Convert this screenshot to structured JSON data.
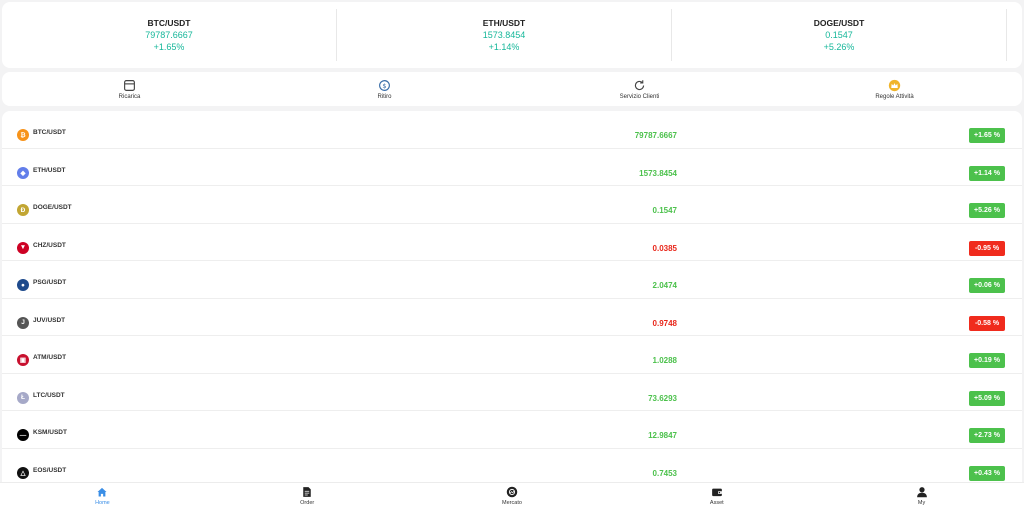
{
  "tickers": [
    {
      "pair": "BTC/USDT",
      "price": "79787.6667",
      "change": "+1.65%"
    },
    {
      "pair": "ETH/USDT",
      "price": "1573.8454",
      "change": "+1.14%"
    },
    {
      "pair": "DOGE/USDT",
      "price": "0.1547",
      "change": "+5.26%"
    }
  ],
  "actions": [
    {
      "label": "Ricarica",
      "icon": "card-icon"
    },
    {
      "label": "Ritiro",
      "icon": "coin-withdraw-icon"
    },
    {
      "label": "Servizio Clienti",
      "icon": "refresh-support-icon"
    },
    {
      "label": "Regole Attività",
      "icon": "crown-icon"
    }
  ],
  "markets": [
    {
      "pair": "BTC/USDT",
      "price": "79787.6667",
      "change": "+1.65 %",
      "icon_glyph": "₿",
      "icon_color": "#f7931a"
    },
    {
      "pair": "ETH/USDT",
      "price": "1573.8454",
      "change": "+1.14 %",
      "icon_glyph": "◆",
      "icon_color": "#627eea"
    },
    {
      "pair": "DOGE/USDT",
      "price": "0.1547",
      "change": "+5.26 %",
      "icon_glyph": "Ð",
      "icon_color": "#c2a633"
    },
    {
      "pair": "CHZ/USDT",
      "price": "0.0385",
      "change": "-0.95 %",
      "icon_glyph": "▼",
      "icon_color": "#cd0124"
    },
    {
      "pair": "PSG/USDT",
      "price": "2.0474",
      "change": "+0.06 %",
      "icon_glyph": "●",
      "icon_color": "#1e4a8c"
    },
    {
      "pair": "JUV/USDT",
      "price": "0.9748",
      "change": "-0.58 %",
      "icon_glyph": "J",
      "icon_color": "#555555"
    },
    {
      "pair": "ATM/USDT",
      "price": "1.0288",
      "change": "+0.19 %",
      "icon_glyph": "▣",
      "icon_color": "#c8102e"
    },
    {
      "pair": "LTC/USDT",
      "price": "73.6293",
      "change": "+5.09 %",
      "icon_glyph": "Ł",
      "icon_color": "#a6a9c8"
    },
    {
      "pair": "KSM/USDT",
      "price": "12.9847",
      "change": "+2.73 %",
      "icon_glyph": "—",
      "icon_color": "#000000"
    },
    {
      "pair": "EOS/USDT",
      "price": "0.7453",
      "change": "+0.43 %",
      "icon_glyph": "△",
      "icon_color": "#111111"
    }
  ],
  "nav": [
    {
      "label": "Home",
      "icon": "home-icon",
      "active": true
    },
    {
      "label": "Order",
      "icon": "document-icon",
      "active": false
    },
    {
      "label": "Mercato",
      "icon": "market-icon",
      "active": false
    },
    {
      "label": "Asset",
      "icon": "wallet-icon",
      "active": false
    },
    {
      "label": "My",
      "icon": "user-icon",
      "active": false
    }
  ],
  "colors": {
    "up": "#16b79a",
    "up_list": "#4cc14c",
    "badge_up": "#4cc14c",
    "badge_down": "#f02b1d",
    "down": "#e8261a",
    "accent": "#3a8ee6"
  }
}
